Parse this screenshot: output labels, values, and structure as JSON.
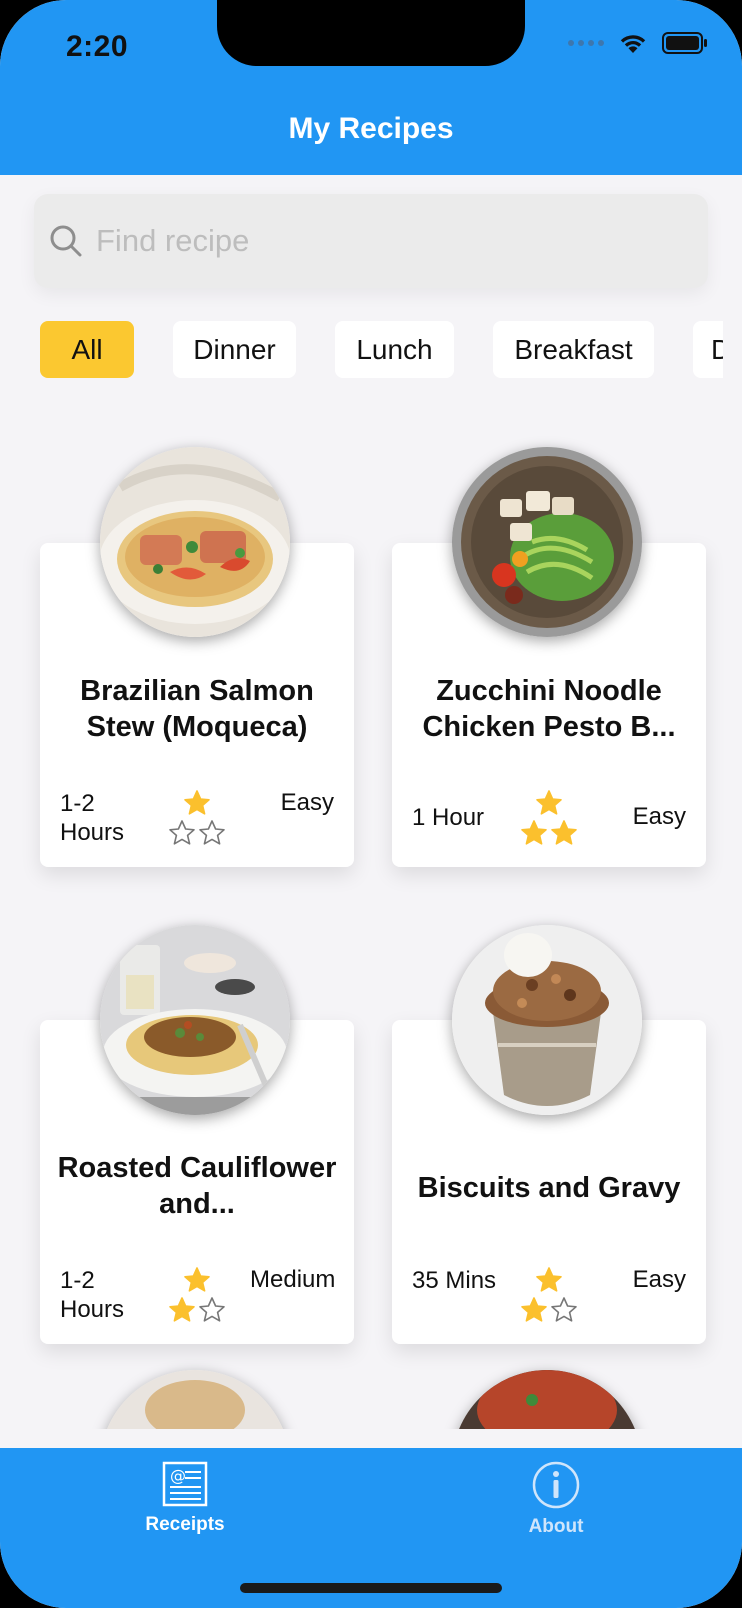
{
  "status": {
    "time": "2:20"
  },
  "header": {
    "title": "My Recipes"
  },
  "search": {
    "placeholder": "Find recipe",
    "value": ""
  },
  "categories": [
    {
      "label": "All",
      "active": true
    },
    {
      "label": "Dinner",
      "active": false
    },
    {
      "label": "Lunch",
      "active": false
    },
    {
      "label": "Breakfast",
      "active": false
    },
    {
      "label": "D",
      "active": false
    }
  ],
  "recipes": [
    {
      "name": "Brazilian Salmon Stew  (Moqueca)",
      "time": "1-2 Hours",
      "rating": 1,
      "max_rating": 3,
      "difficulty": "Easy"
    },
    {
      "name": "Zucchini Noodle Chicken Pesto B...",
      "time": "1 Hour",
      "rating": 3,
      "max_rating": 3,
      "difficulty": "Easy"
    },
    {
      "name": "Roasted Cauliflower and...",
      "time": "1-2 Hours",
      "rating": 2,
      "max_rating": 3,
      "difficulty": "Medium"
    },
    {
      "name": "Biscuits and Gravy",
      "time": "35 Mins",
      "rating": 2,
      "max_rating": 3,
      "difficulty": "Easy"
    }
  ],
  "tabbar": {
    "tabs": [
      {
        "label": "Receipts",
        "icon": "recipe-book-icon",
        "active": true
      },
      {
        "label": "About",
        "icon": "info-icon",
        "active": false
      }
    ]
  },
  "colors": {
    "primary": "#2196f3",
    "accent": "#fbc830",
    "star": "#fbc02d",
    "background": "#f5f4f7"
  }
}
